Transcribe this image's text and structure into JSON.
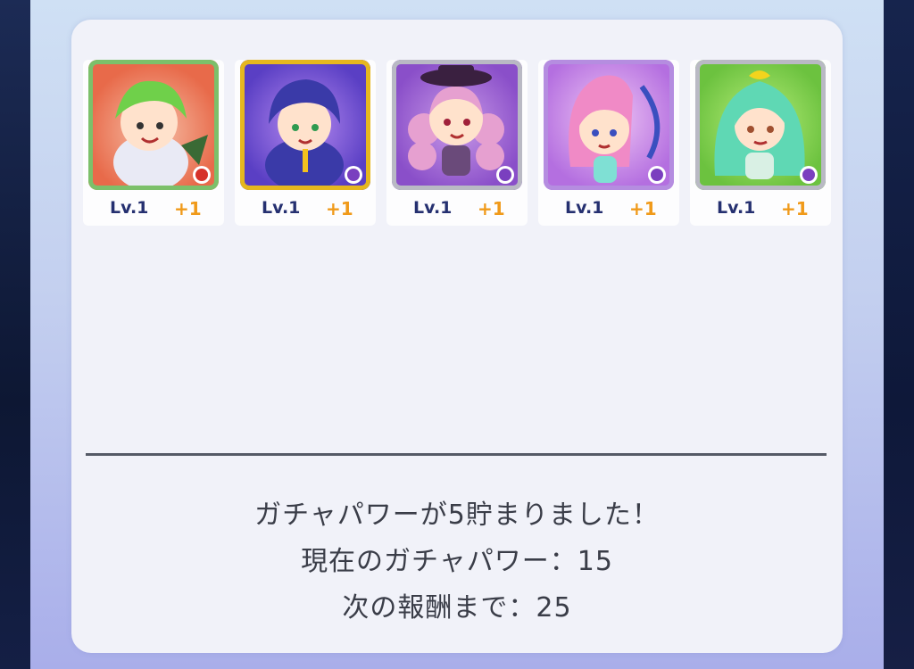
{
  "cards": [
    {
      "level": "Lv.1",
      "bonus": "+1",
      "frame_color": "#7cc06a",
      "bg_color": "#e86a4a",
      "hair_color": "#6fd04a",
      "orb_icon": "red-orb-icon",
      "orb_color": "#d6322a"
    },
    {
      "level": "Lv.1",
      "bonus": "+1",
      "frame_color": "#e6b71e",
      "bg_color": "#5a3fc4",
      "hair_color": "#3a3aa8",
      "orb_icon": "purple-orb-icon",
      "orb_color": "#7a3fbf"
    },
    {
      "level": "Lv.1",
      "bonus": "+1",
      "frame_color": "#b9b9c4",
      "bg_color": "#8a4fc9",
      "hair_color": "#e6a0d0",
      "orb_icon": "purple-orb-icon",
      "orb_color": "#7a3fbf"
    },
    {
      "level": "Lv.1",
      "bonus": "+1",
      "frame_color": "#b58de0",
      "bg_color": "#b46fe0",
      "hair_color": "#f08ac6",
      "orb_icon": "purple-orb-icon",
      "orb_color": "#7a3fbf"
    },
    {
      "level": "Lv.1",
      "bonus": "+1",
      "frame_color": "#b9b9c4",
      "bg_color": "#6cc23f",
      "hair_color": "#5fd8b4",
      "orb_icon": "purple-orb-icon",
      "orb_color": "#7a3fbf"
    }
  ],
  "messages": {
    "line1": "ガチャパワーが5貯まりました！",
    "line2": "現在のガチャパワー：15",
    "line3": "次の報酬まで：25"
  }
}
